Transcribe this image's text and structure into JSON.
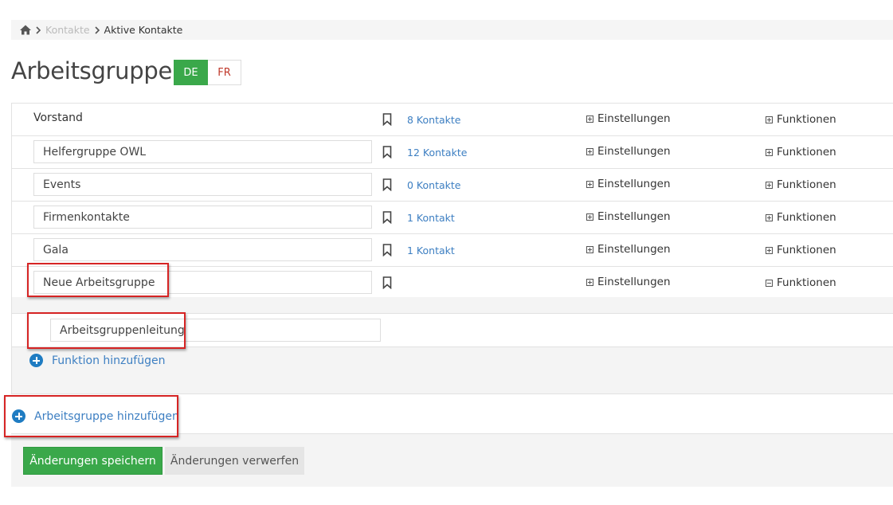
{
  "breadcrumb": {
    "home_icon": "home-icon",
    "link": "Kontakte",
    "current": "Aktive Kontakte"
  },
  "page": {
    "title": "Arbeitsgruppen"
  },
  "languages": [
    {
      "code": "DE",
      "active": true
    },
    {
      "code": "FR",
      "active": false
    }
  ],
  "colors": {
    "accent_green": "#3aa84a",
    "link_blue": "#3d7fc2",
    "highlight_red": "#d62424",
    "lang_fr_red": "#c0392b"
  },
  "groups": [
    {
      "name": "Vorstand",
      "editable": false,
      "contacts": "8 Kontakte",
      "settings": "Einstellungen",
      "functions": "Funktionen"
    },
    {
      "name": "Helfergruppe OWL",
      "editable": true,
      "contacts": "12 Kontakte",
      "settings": "Einstellungen",
      "functions": "Funktionen"
    },
    {
      "name": "Events",
      "editable": true,
      "contacts": "0 Kontakte",
      "settings": "Einstellungen",
      "functions": "Funktionen"
    },
    {
      "name": "Firmenkontakte",
      "editable": true,
      "contacts": "1 Kontakt",
      "settings": "Einstellungen",
      "functions": "Funktionen"
    },
    {
      "name": "Gala",
      "editable": true,
      "contacts": "1 Kontakt",
      "settings": "Einstellungen",
      "functions": "Funktionen"
    },
    {
      "name": "Neue Arbeitsgruppe",
      "editable": true,
      "contacts": "",
      "settings": "Einstellungen",
      "functions": "Funktionen"
    }
  ],
  "function_panel": {
    "function_name": "Arbeitsgruppenleitung",
    "add_function": "Funktion hinzufügen"
  },
  "add_group": "Arbeitsgruppe hinzufügen",
  "footer": {
    "save": "Änderungen speichern",
    "discard": "Änderungen verwerfen"
  }
}
